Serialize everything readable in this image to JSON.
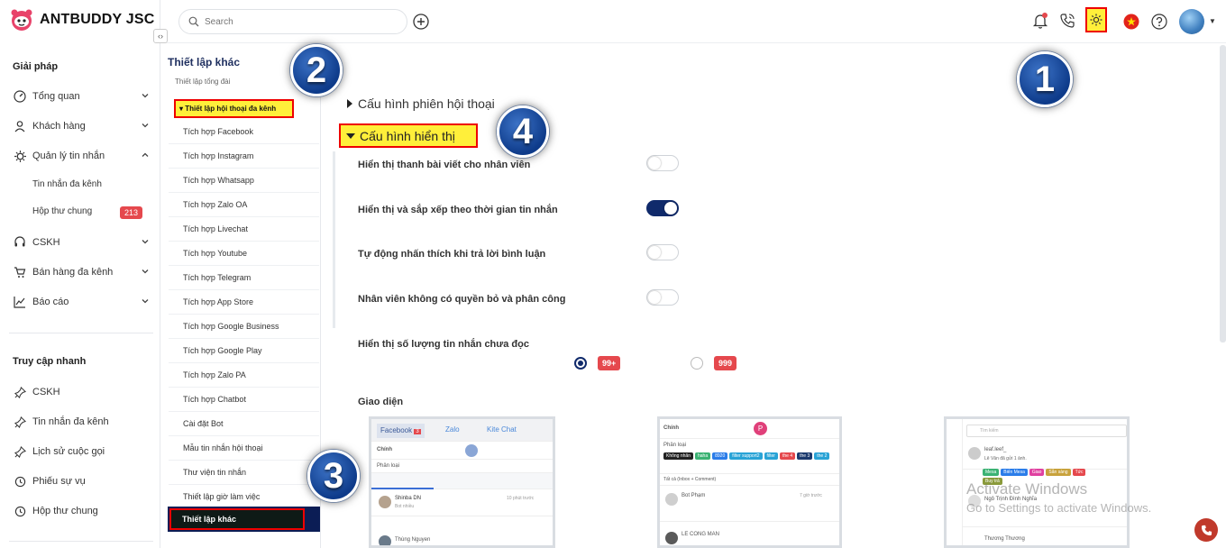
{
  "app": {
    "brand": "ANTBUDDY JSC"
  },
  "sidebar": {
    "solutions_title": "Giải pháp",
    "items": [
      {
        "label": "Tổng quan",
        "icon": "gauge-icon"
      },
      {
        "label": "Khách hàng",
        "icon": "user-icon"
      },
      {
        "label": "Quản lý tin nhắn",
        "icon": "message-gear-icon"
      },
      {
        "label": "CSKH",
        "icon": "headset-icon"
      },
      {
        "label": "Bán hàng đa kênh",
        "icon": "cart-icon"
      },
      {
        "label": "Báo cáo",
        "icon": "chart-icon"
      }
    ],
    "sub_items": [
      {
        "label": "Tin nhắn đa kênh"
      },
      {
        "label": "Hộp thư chung",
        "badge": "213"
      }
    ],
    "quick_title": "Truy cập nhanh",
    "quick_items": [
      {
        "label": "CSKH"
      },
      {
        "label": "Tin nhắn đa kênh"
      },
      {
        "label": "Lịch sử cuộc gọi"
      },
      {
        "label": "Phiếu sự vụ"
      },
      {
        "label": "Hộp thư chung"
      }
    ]
  },
  "topbar": {
    "search_placeholder": "Search"
  },
  "page": {
    "title": "Thiết lập khác"
  },
  "settings_list": {
    "top_partial": "Thiết lập tổng đài",
    "highlighted": "▾ Thiết lập hội thoại đa kênh",
    "items": [
      "Tích hợp Facebook",
      "Tích hợp Instagram",
      "Tích hợp Whatsapp",
      "Tích hợp Zalo OA",
      "Tích hợp Livechat",
      "Tích hợp Youtube",
      "Tích hợp Telegram",
      "Tích hợp App Store",
      "Tích hợp Google Business",
      "Tích hợp Google Play",
      "Tích hợp Zalo PA",
      "Tích hợp Chatbot",
      "Cài đặt Bot",
      "Mẫu tin nhắn hội thoại",
      "Thư viện tin nhắn",
      "Thiết lập giờ làm việc"
    ],
    "active": "Thiết lập khác"
  },
  "main": {
    "section_collapsed": "Cấu hình phiên hội thoại",
    "section_open": "Cấu hình hiển thị",
    "options": [
      {
        "label": "Hiển thị thanh bài viết cho nhân viên",
        "on": false
      },
      {
        "label": "Hiển thị và sắp xếp theo thời gian tin nhắn",
        "on": true
      },
      {
        "label": "Tự động nhấn thích khi trả lời bình luận",
        "on": false
      },
      {
        "label": "Nhân viên không có quyền bỏ và phân công",
        "on": false
      }
    ],
    "unread_label": "Hiển thị số lượng tin nhắn chưa đọc",
    "unread_choices": [
      {
        "text": "99+",
        "selected": true
      },
      {
        "text": "999",
        "selected": false
      }
    ],
    "theme_label": "Giao diện"
  },
  "thumbs": {
    "t1": {
      "tab_fb": "Facebook",
      "fb_count": "3",
      "tab_zalo": "Zalo",
      "tab_kite": "Kite Chat",
      "chinh": "Chính",
      "phan_loai": "Phân loại",
      "contact1": "Shinba DN",
      "contact1_msg": "Bot nhiều",
      "contact1_time": "10 phút trước",
      "contact2": "Thùng Nguyen"
    },
    "t2": {
      "chinh": "Chính",
      "avatar_letter": "P",
      "phan_loai": "Phân loại",
      "tags": [
        "Không nhãn",
        "haha",
        "8920",
        "filter support2",
        "filter",
        "the 4",
        "the 3",
        "the 2"
      ],
      "filter": "Tất cả (Inbox + Comment)",
      "contact1": "Bot Phạm",
      "contact1_time": "7 giờ trước",
      "contact2": "LE CONG MAN"
    },
    "t3": {
      "search": "Tìm kiếm",
      "contact1": "leaf.leef_",
      "contact1_msg": "Lê Văn đã gửi 1 ảnh.",
      "tags": [
        "Mesa",
        "Biến Mesa",
        "Giao",
        "Sẵn sàng",
        "Tức",
        "Buy trả"
      ],
      "contact2": "Ngô Trịnh Đình Nghĩa",
      "contact3": "Thương Thương"
    }
  },
  "callouts": [
    "1",
    "2",
    "3",
    "4"
  ],
  "watermark": {
    "line1": "Activate Windows",
    "line2": "Go to Settings to activate Windows."
  },
  "colors": {
    "accent": "#102a6b",
    "highlight": "#ffef3a",
    "red": "#e5484d"
  }
}
